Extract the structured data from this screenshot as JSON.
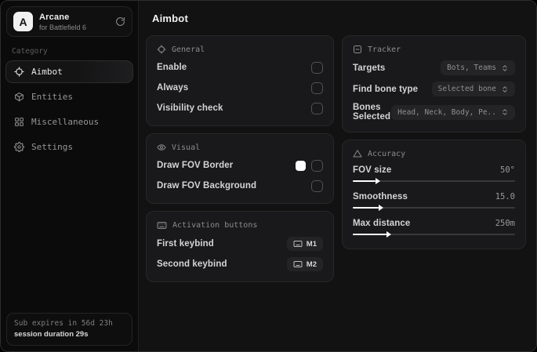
{
  "sidebar": {
    "logo": {
      "letter": "A",
      "title": "Arcane",
      "subtitle": "for Battlefield 6"
    },
    "category_label": "Category",
    "items": [
      {
        "label": "Aimbot",
        "icon": "crosshair-icon",
        "selected": true
      },
      {
        "label": "Entities",
        "icon": "cube-icon",
        "selected": false
      },
      {
        "label": "Miscellaneous",
        "icon": "grid-icon",
        "selected": false
      },
      {
        "label": "Settings",
        "icon": "gear-icon",
        "selected": false
      }
    ],
    "footer": {
      "expiry": "Sub expires in 56d 23h",
      "session": "session duration 29s"
    }
  },
  "main": {
    "title": "Aimbot",
    "general": {
      "title": "General",
      "rows": [
        {
          "label": "Enable",
          "checked": false
        },
        {
          "label": "Always",
          "checked": false
        },
        {
          "label": "Visibility check",
          "checked": false
        }
      ]
    },
    "visual": {
      "title": "Visual",
      "rows": [
        {
          "label": "Draw FOV Border",
          "swatch_color": "#ffffff",
          "checked": false
        },
        {
          "label": "Draw FOV Background",
          "checked": false
        }
      ]
    },
    "activation": {
      "title": "Activation buttons",
      "rows": [
        {
          "label": "First keybind",
          "key": "M1"
        },
        {
          "label": "Second keybind",
          "key": "M2"
        }
      ]
    },
    "tracker": {
      "title": "Tracker",
      "rows": [
        {
          "label": "Targets",
          "value": "Bots, Teams"
        },
        {
          "label": "Find bone type",
          "value": "Selected bone"
        },
        {
          "label": "Bones Selected",
          "value": "Head, Neck, Body, Pe.."
        }
      ]
    },
    "accuracy": {
      "title": "Accuracy",
      "rows": [
        {
          "label": "FOV size",
          "value": "50°",
          "fill_percent": 14
        },
        {
          "label": "Smoothness",
          "value": "15.0",
          "fill_percent": 16
        },
        {
          "label": "Max distance",
          "value": "250m",
          "fill_percent": 21
        }
      ]
    }
  }
}
